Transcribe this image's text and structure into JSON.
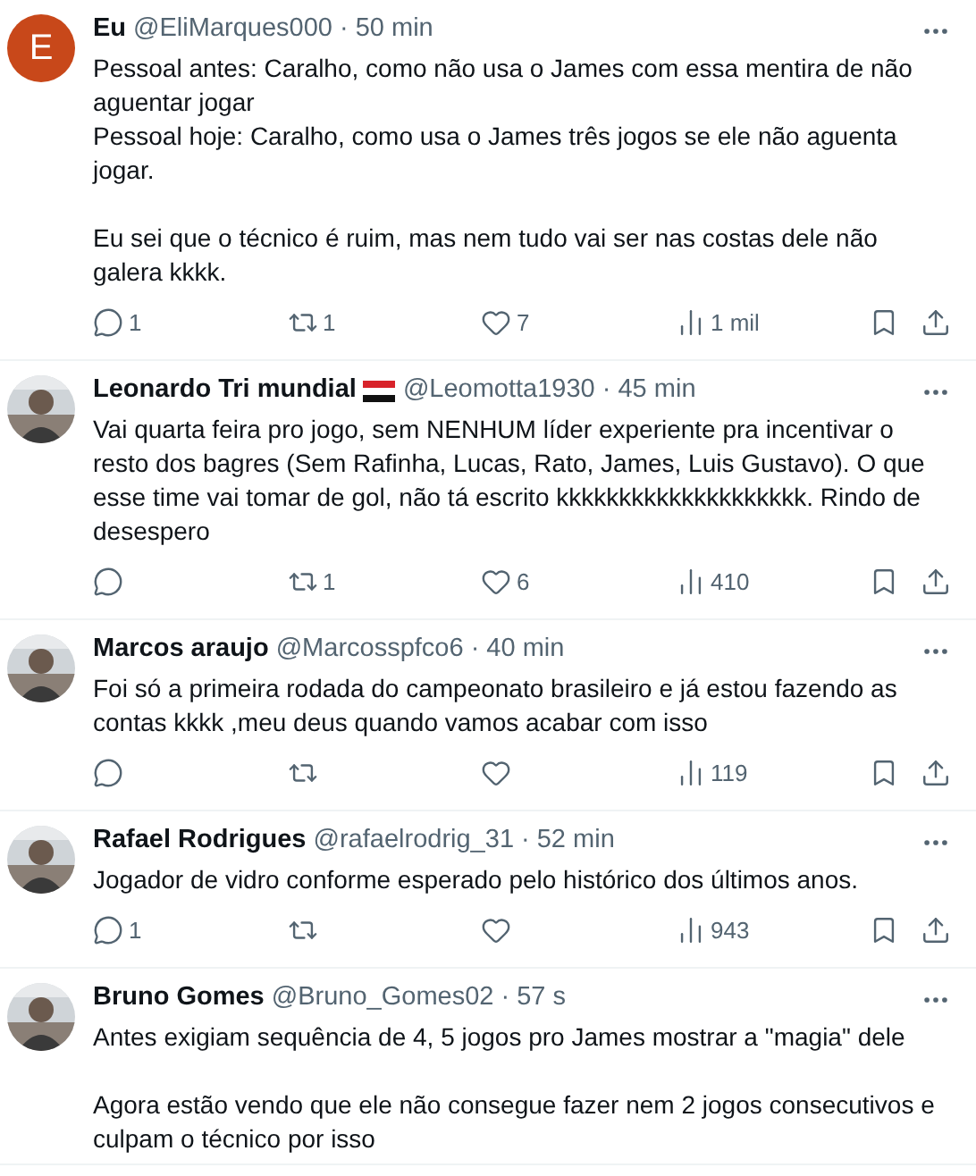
{
  "tweets": [
    {
      "avatar": {
        "kind": "letter",
        "letter": "E"
      },
      "name": "Eu",
      "has_flag": false,
      "handle": "@EliMarques000",
      "time": "· 50 min",
      "text": "Pessoal antes: Caralho, como não usa o James com essa mentira de não aguentar jogar\nPessoal hoje: Caralho, como usa o James três jogos se ele não aguenta jogar.\n\nEu sei que o técnico é ruim, mas nem tudo vai ser nas costas dele não galera kkkk.",
      "replies": "1",
      "reposts": "1",
      "likes": "7",
      "views": "1 mil"
    },
    {
      "name": "Leonardo Tri mundial",
      "has_flag": true,
      "handle": "@Leomotta1930",
      "time": "· 45 min",
      "text": "Vai quarta feira pro jogo, sem NENHUM líder experiente pra incentivar o resto dos bagres (Sem Rafinha, Lucas, Rato, James, Luis Gustavo). O que esse time vai tomar de gol, não tá escrito kkkkkkkkkkkkkkkkkkkk. Rindo de desespero",
      "reposts": "1",
      "likes": "6",
      "views": "410"
    },
    {
      "name": "Marcos araujo",
      "has_flag": false,
      "handle": "@Marcosspfco6",
      "time": "· 40 min",
      "text": "Foi só a primeira rodada do campeonato brasileiro e já estou fazendo as contas kkkk ,meu deus quando vamos acabar com isso",
      "views": "119"
    },
    {
      "name": "Rafael Rodrigues",
      "has_flag": false,
      "handle": "@rafaelrodrig_31",
      "time": "· 52 min",
      "text": "Jogador de vidro conforme esperado pelo histórico dos últimos anos.",
      "replies": "1",
      "views": "943"
    },
    {
      "name": "Bruno Gomes",
      "has_flag": false,
      "handle": "@Bruno_Gomes02",
      "time": "· 57 s",
      "text": "Antes exigiam sequência de 4, 5 jogos pro James mostrar a \"magia\" dele\n\nAgora estão vendo que ele não consegue fazer nem 2 jogos consecutivos e culpam o técnico por isso"
    }
  ]
}
